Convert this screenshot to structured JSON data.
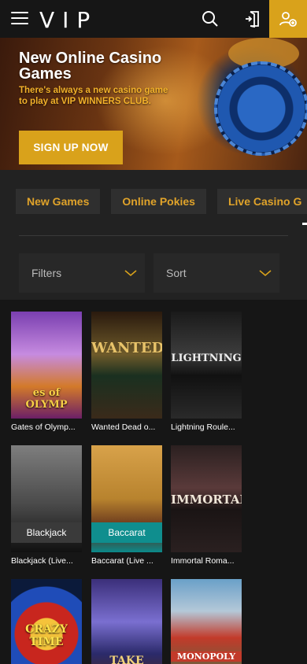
{
  "header": {
    "logo_text": "VIP",
    "icons": [
      "hamburger-menu-icon",
      "search-icon",
      "login-icon",
      "register-user-icon"
    ],
    "accent_color": "#d9a21b"
  },
  "banner": {
    "title": "New Online Casino Games",
    "subtitle": "There's always a new casino game to play at VIP WINNERS CLUB.",
    "cta_label": "SIGN UP NOW"
  },
  "categories": [
    {
      "label": "New Games"
    },
    {
      "label": "Online Pokies"
    },
    {
      "label": "Live Casino G"
    }
  ],
  "filters": {
    "filters_label": "Filters",
    "sort_label": "Sort"
  },
  "games": [
    {
      "name": "Gates of Olymp...",
      "art": "es of OLYMP"
    },
    {
      "name": "Wanted Dead o...",
      "art": "WANTED"
    },
    {
      "name": "Lightning Roule...",
      "art": "LIGHTNING"
    },
    {
      "name": "Blackjack (Live...",
      "art": "Blackjack"
    },
    {
      "name": "Baccarat (Live ...",
      "art": "Baccarat"
    },
    {
      "name": "Immortal Roma...",
      "art": "IMMORTAL"
    },
    {
      "name": "",
      "art": "CRAZY TIME"
    },
    {
      "name": "",
      "art": "TAKE"
    },
    {
      "name": "",
      "art": "MONOPOLY"
    }
  ]
}
